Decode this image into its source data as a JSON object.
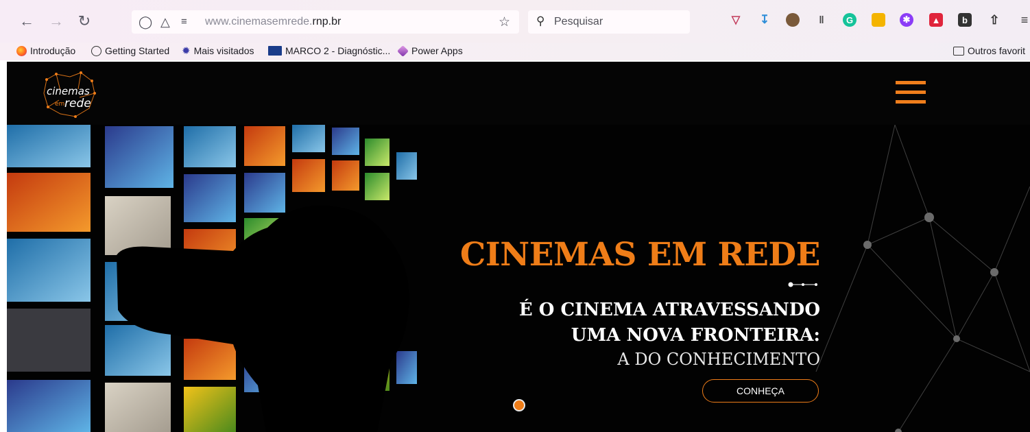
{
  "browser": {
    "url_domain": "www.cinemasemrede.",
    "url_host": "rnp.br",
    "search_placeholder": "Pesquisar",
    "icons": [
      "back-arrow-icon",
      "forward-arrow-icon",
      "reload-icon",
      "shield-icon",
      "permissions-icon",
      "site-settings-icon",
      "star-icon",
      "search-icon",
      "pocket-icon",
      "download-icon",
      "extension-icon",
      "extension-bars-icon",
      "grammarly-icon",
      "extension-orange-icon",
      "extension-purple-icon",
      "extension-red-icon",
      "extension-b-icon",
      "share-icon",
      "menu-icon"
    ]
  },
  "bookmarks": {
    "items": [
      {
        "label": "Introdução",
        "icon": "firefox-icon"
      },
      {
        "label": "Getting Started",
        "icon": "globe-icon"
      },
      {
        "label": "Mais visitados",
        "icon": "gear-icon"
      },
      {
        "label": "MARCO 2 - Diagnóstic...",
        "icon": "marco-icon"
      },
      {
        "label": "Power Apps",
        "icon": "power-apps-icon"
      }
    ],
    "other": "Outros favorit"
  },
  "site": {
    "logo_alt": "cinemas em rede",
    "heading": "CINEMAS EM REDE",
    "subtitle_line1": "É O CINEMA ATRAVESSANDO",
    "subtitle_line2": "UMA NOVA FRONTEIRA:",
    "subtitle_line3": "A DO CONHECIMENTO",
    "cta_label": "CONHEÇA",
    "accent_color": "#ef7d18"
  }
}
